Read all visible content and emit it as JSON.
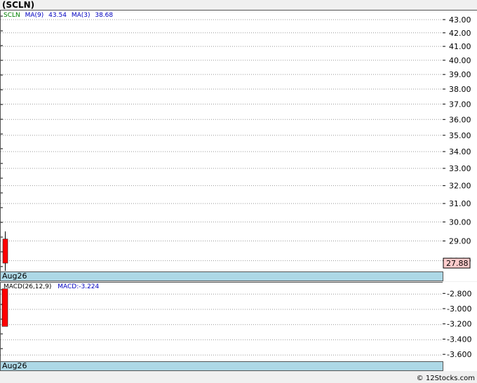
{
  "title": "(SCLN)",
  "legend": {
    "symbol": "SCLN",
    "ma9_label": "MA(9)",
    "ma9_value": "43.54",
    "ma3_label": "MA(3)",
    "ma3_value": "38.68"
  },
  "macd_legend": {
    "label": "MACD(26,12,9)",
    "value": "MACD:-3.224"
  },
  "date_label": "Aug26",
  "date_label_bottom": "Aug26",
  "last_price": "27.88",
  "credit": "© 12Stocks.com",
  "colors": {
    "candle": "#ff0000",
    "strip": "#add8e6",
    "legend_symbol": "#008000",
    "legend_ma": "#0000c0",
    "price_box": "#ffcccc"
  },
  "chart_data": [
    {
      "type": "candlestick",
      "y_ticks": [
        "43.00",
        "42.00",
        "41.00",
        "40.00",
        "39.00",
        "38.00",
        "37.00",
        "36.00",
        "35.00",
        "34.00",
        "33.00",
        "32.00",
        "31.00",
        "30.00",
        "29.00",
        "28.00"
      ],
      "y_tick_values": [
        43,
        42,
        41,
        40,
        39,
        38,
        37,
        36,
        35,
        34,
        33,
        32,
        31,
        30,
        29,
        28
      ],
      "scale": "log",
      "ylim": [
        27.4,
        43.7
      ],
      "categories": [
        "Aug26"
      ],
      "candles": [
        {
          "date": "Aug26",
          "open": 29.1,
          "close": 27.88,
          "high": 29.5,
          "low": 27.5
        }
      ],
      "grid": true
    },
    {
      "type": "bar",
      "title": "MACD(26,12,9)",
      "y_ticks": [
        "-2.800",
        "-3.000",
        "-3.200",
        "-3.400",
        "-3.600"
      ],
      "y_tick_values": [
        -2.8,
        -3.0,
        -3.2,
        -3.4,
        -3.6
      ],
      "ylim": [
        -3.7,
        -2.65
      ],
      "categories": [
        "Aug26"
      ],
      "values": [
        {
          "date": "Aug26",
          "top": -2.73,
          "bottom": -3.224
        }
      ],
      "grid": true
    }
  ]
}
